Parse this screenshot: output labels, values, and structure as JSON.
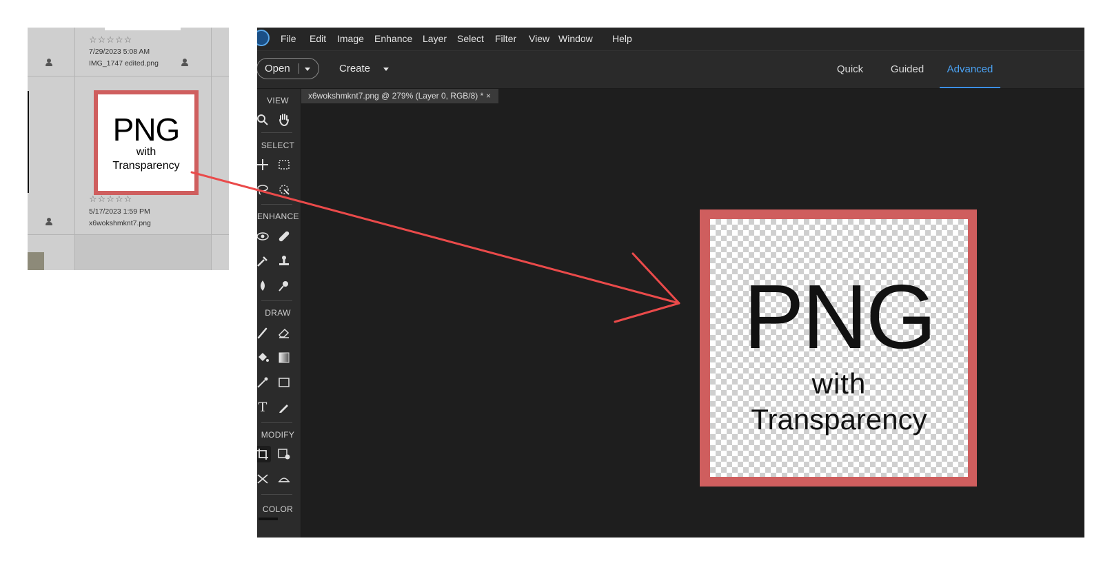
{
  "organizer": {
    "item1": {
      "rating": "☆☆☆☆☆",
      "date": "7/29/2023 5:08 AM",
      "filename": "IMG_1747 edited.png"
    },
    "item2": {
      "rating": "☆☆☆☆☆",
      "date": "5/17/2023 1:59 PM",
      "filename": "x6wokshmknt7.png",
      "thumb_line1": "PNG",
      "thumb_line2": "with",
      "thumb_line3": "Transparency"
    }
  },
  "menubar": {
    "items": [
      "File",
      "Edit",
      "Image",
      "Enhance",
      "Layer",
      "Select",
      "Filter",
      "View",
      "Window",
      "Help"
    ]
  },
  "toolbar": {
    "open_label": "Open",
    "create_label": "Create",
    "modes": [
      "Quick",
      "Guided",
      "Advanced"
    ],
    "active_mode": "Advanced"
  },
  "tools": {
    "sections": [
      "VIEW",
      "SELECT",
      "ENHANCE",
      "DRAW",
      "MODIFY",
      "COLOR"
    ],
    "type_glyph": "T"
  },
  "document": {
    "tab_title": "x6wokshmknt7.png @ 279% (Layer 0, RGB/8) *",
    "close_glyph": "×",
    "canvas_line1": "PNG",
    "canvas_line2": "with",
    "canvas_line3": "Transparency"
  },
  "colors": {
    "accent": "#4ba3f5",
    "frame_red": "#cf5e5e",
    "annotation_arrow": "#ea4a4a"
  }
}
